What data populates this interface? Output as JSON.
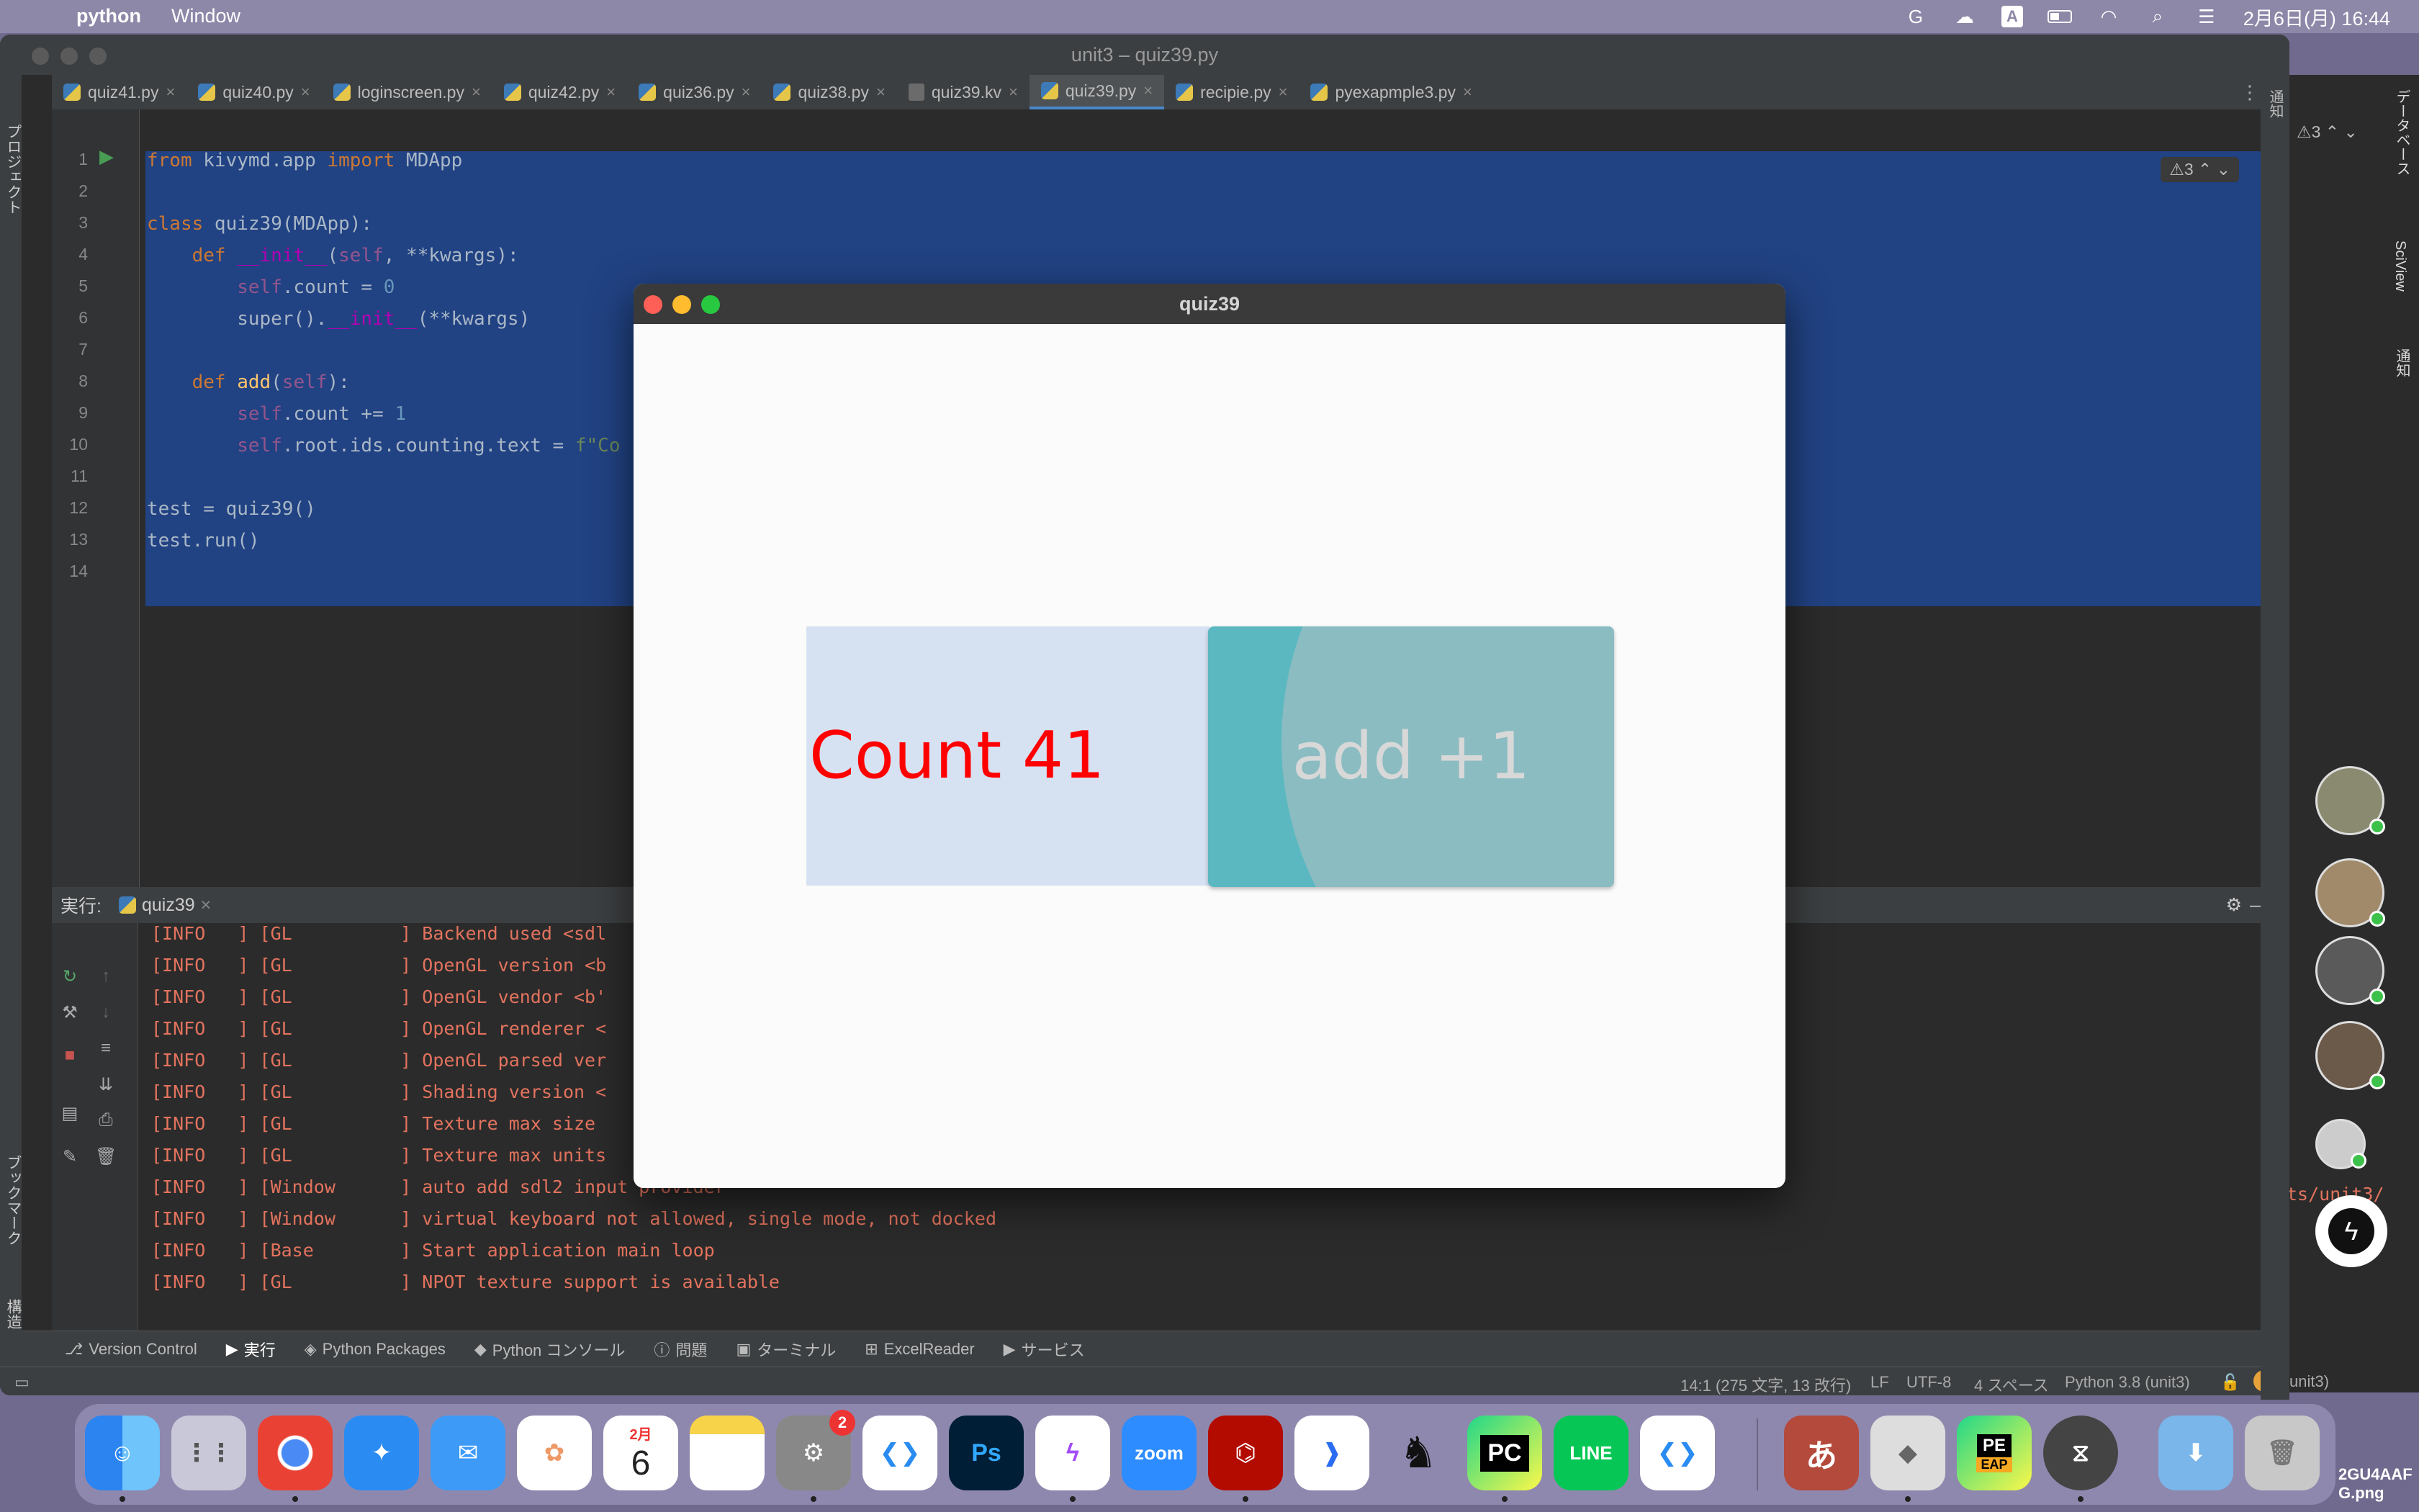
{
  "menubar": {
    "app_name": "python",
    "menu_window": "Window",
    "datetime": "2月6日(月) 16:44"
  },
  "ide": {
    "title": "unit3 – quiz39.py",
    "left_strip_labels": [
      "プロジェクト",
      "ブックマーク",
      "構造"
    ],
    "tabs": [
      {
        "label": "quiz41.py",
        "type": "py",
        "active": false
      },
      {
        "label": "quiz40.py",
        "type": "py",
        "active": false
      },
      {
        "label": "loginscreen.py",
        "type": "py",
        "active": false
      },
      {
        "label": "quiz42.py",
        "type": "py",
        "active": false
      },
      {
        "label": "quiz36.py",
        "type": "py",
        "active": false
      },
      {
        "label": "quiz38.py",
        "type": "py",
        "active": false
      },
      {
        "label": "quiz39.kv",
        "type": "kv",
        "active": false
      },
      {
        "label": "quiz39.py",
        "type": "py",
        "active": true
      },
      {
        "label": "recipie.py",
        "type": "py",
        "active": false
      },
      {
        "label": "pyexapmple3.py",
        "type": "py",
        "active": false
      }
    ],
    "warning_count": "⚠3",
    "warning_count_right": "⚠3",
    "code_lines": [
      "from kivymd.app import MDApp",
      "",
      "class quiz39(MDApp):",
      "    def __init__(self, **kwargs):",
      "        self.count = 0",
      "        super().__init__(**kwargs)",
      "",
      "    def add(self):",
      "        self.count += 1",
      "        self.root.ids.counting.text = f\"Co",
      "",
      "test = quiz39()",
      "test.run()",
      ""
    ],
    "line_numbers": [
      "1",
      "2",
      "3",
      "4",
      "5",
      "6",
      "7",
      "8",
      "9",
      "10",
      "11",
      "12",
      "13",
      "14"
    ]
  },
  "run": {
    "label": "実行:",
    "tab": "quiz39",
    "log_lines": [
      "[INFO   ] [GL          ] Backend used <sdl",
      "[INFO   ] [GL          ] OpenGL version <b",
      "[INFO   ] [GL          ] OpenGL vendor <b'",
      "[INFO   ] [GL          ] OpenGL renderer <",
      "[INFO   ] [GL          ] OpenGL parsed ver",
      "[INFO   ] [GL          ] Shading version <",
      "[INFO   ] [GL          ] Texture max size",
      "[INFO   ] [GL          ] Texture max units",
      "[INFO   ] [Window      ] auto add sdl2 input provider",
      "[INFO   ] [Window      ] virtual keyboard not allowed, single mode, not docked",
      "[INFO   ] [Base        ] Start application main loop",
      "[INFO   ] [GL          ] NPOT texture support is available"
    ]
  },
  "bottom_tabs": [
    {
      "label": "Version Control",
      "active": false
    },
    {
      "label": "実行",
      "active": true
    },
    {
      "label": "Python Packages",
      "active": false
    },
    {
      "label": "Python コンソール",
      "active": false
    },
    {
      "label": "問題",
      "active": false
    },
    {
      "label": "ターミナル",
      "active": false
    },
    {
      "label": "ExcelReader",
      "active": false
    },
    {
      "label": "サービス",
      "active": false
    }
  ],
  "statusbar": {
    "position": "14:1 (275 文字, 13 改行)",
    "line_sep": "LF",
    "encoding": "UTF-8",
    "indent": "4 スペース",
    "interpreter": "Python 3.8 (unit3)",
    "overflow": "unit3)"
  },
  "right_sidebar_labels": [
    "通知",
    "データベース",
    "SciView",
    "通知"
  ],
  "partial_text": "ts/unit3/",
  "kivy_app": {
    "title": "quiz39",
    "count_label": "Count 41",
    "button_label": "add +1"
  },
  "dock": {
    "calendar_month": "2月",
    "calendar_day": "6",
    "settings_badge": "2",
    "apps": [
      "Finder",
      "Launchpad",
      "Chrome",
      "Safari",
      "Mail",
      "Photos",
      "Calendar",
      "Notes",
      "System Settings",
      "VS Code",
      "Photoshop",
      "Messenger",
      "Zoom",
      "Acrobat",
      "Toolbox",
      "Kindle",
      "PyCharm",
      "LINE",
      "VS Code Insiders",
      "Kotoeri",
      "Roblox",
      "PyCharm EAP",
      "Kivy",
      "Downloads",
      "Trash"
    ],
    "zoom_label": "zoom",
    "ps_label": "Ps",
    "pc_label": "PC",
    "line_label": "LINE",
    "pe_label": "PE",
    "eap_label": "EAP",
    "kotoeri_label": "あ"
  },
  "desktop_file": "2GU4AAF\nG.png",
  "colors": {
    "selection": "#214283",
    "count_text": "#ff0000",
    "button_bg": "#5bb8c1",
    "count_bg": "#d6e1f1"
  }
}
